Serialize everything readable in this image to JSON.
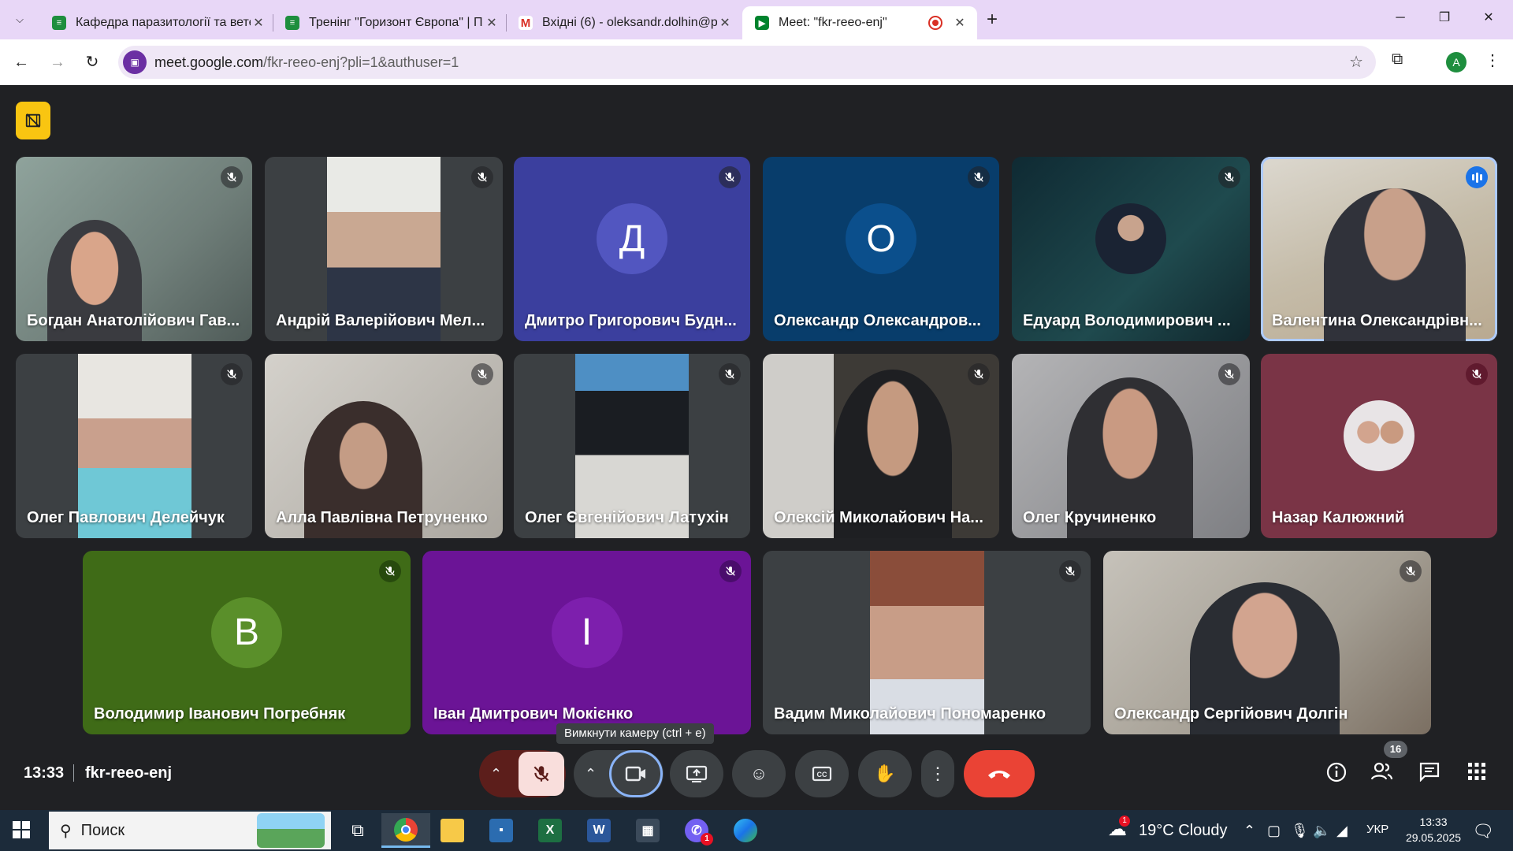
{
  "browser": {
    "tabs": [
      {
        "title": "Кафедра паразитології та ветеринарно-санітарної експертизи",
        "favicon": "sheets-icon",
        "active": false
      },
      {
        "title": "Тренінг \"Горизонт Європа\" | П",
        "favicon": "sheets-icon",
        "active": false
      },
      {
        "title": "Вхідні (6) - oleksandr.dolhin@p",
        "favicon": "gmail-icon",
        "active": false
      },
      {
        "title": "Meet: \"fkr-reeo-enj\"",
        "favicon": "meet-icon",
        "active": true
      }
    ],
    "url_host": "meet.google.com",
    "url_path": "/fkr-reeo-enj?pli=1&authuser=1",
    "profile_initial": "A"
  },
  "meet": {
    "participants": [
      {
        "name": "Богдан Анатолійович Гав...",
        "kind": "video",
        "bg": "#7a8a86"
      },
      {
        "name": "Андрій Валерійович Мел...",
        "kind": "video",
        "bg": "#3c4043"
      },
      {
        "name": "Дмитро Григорович Будн...",
        "initial": "Д",
        "kind": "avatar",
        "bg": "#3b3f9e",
        "avatar_color": "#5256c0"
      },
      {
        "name": "Олександр Олександров...",
        "initial": "О",
        "kind": "avatar",
        "bg": "#083d6b",
        "avatar_color": "#0b4f8c"
      },
      {
        "name": "Едуард Володимирович ...",
        "kind": "photo",
        "bg": "#17333a"
      },
      {
        "name": "Валентина Олександрівн...",
        "kind": "video",
        "bg": "#c9c2b6",
        "speaking": true
      },
      {
        "name": "Олег Павлович Делейчук",
        "kind": "video",
        "bg": "#3c4043"
      },
      {
        "name": "Алла Павлівна Петруненко",
        "kind": "video",
        "bg": "#bdbab5"
      },
      {
        "name": "Олег Євгенійович Латухін",
        "kind": "video",
        "bg": "#3c4043"
      },
      {
        "name": "Олексій Миколайович На...",
        "kind": "video",
        "bg": "#3d3a36"
      },
      {
        "name": "Олег Кручиненко",
        "kind": "video",
        "bg": "#8e8e90"
      },
      {
        "name": "Назар Калюжний",
        "kind": "photo",
        "bg": "#7a3446"
      },
      {
        "name": "Володимир Іванович Погребняк",
        "initial": "В",
        "kind": "avatar",
        "bg": "#3f6b17",
        "avatar_color": "#5a8f2a"
      },
      {
        "name": "Іван Дмитрович Мокієнко",
        "initial": "І",
        "kind": "avatar",
        "bg": "#6b1496",
        "avatar_color": "#7d1fad"
      },
      {
        "name": "Вадим Миколайович Пономаренко",
        "kind": "video",
        "bg": "#3c4043"
      },
      {
        "name": "Олександр Сергійович Долгін",
        "kind": "video",
        "bg": "#a8a49c"
      }
    ],
    "time": "13:33",
    "meeting_code": "fkr-reeo-enj",
    "tooltip": "Вимкнути камеру (ctrl + e)",
    "people_count": "16",
    "colors": {
      "end_call": "#ea4335",
      "mic_off": "#f9dedc",
      "mic_off_wrap": "#5c1e1b",
      "accent_speaking": "#1a73e8"
    }
  },
  "taskbar": {
    "search_placeholder": "Поиск",
    "weather": "19°C  Cloudy",
    "weather_badge": "1",
    "language": "УКР",
    "clock_time": "13:33",
    "clock_date": "29.05.2025",
    "viber_badge": "1"
  }
}
